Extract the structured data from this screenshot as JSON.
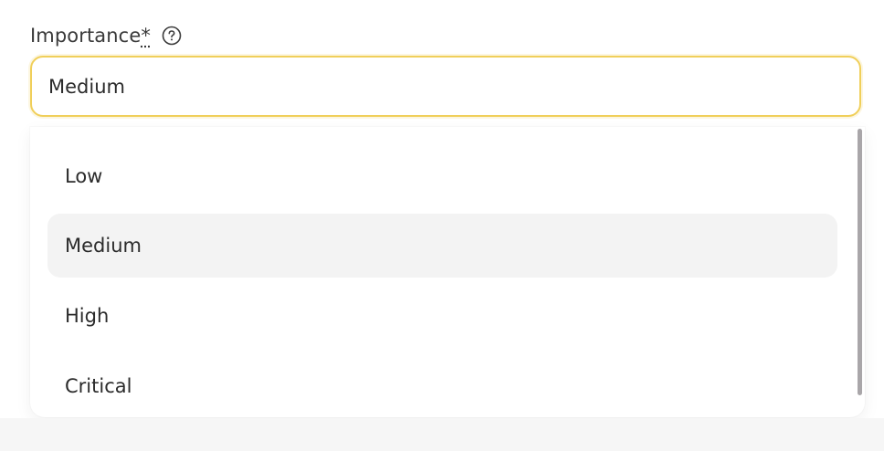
{
  "field": {
    "label": "Importance",
    "required_mark": "*",
    "help_icon": "question-circle-icon"
  },
  "select": {
    "value": "Medium"
  },
  "dropdown": {
    "options": [
      {
        "label": "Low"
      },
      {
        "label": "Medium"
      },
      {
        "label": "High"
      },
      {
        "label": "Critical"
      }
    ],
    "highlighted_index": 1
  },
  "colors": {
    "focus_border": "#f0cf5a",
    "highlight_bg": "#f3f3f3",
    "scrollbar": "#a9a6a9"
  }
}
